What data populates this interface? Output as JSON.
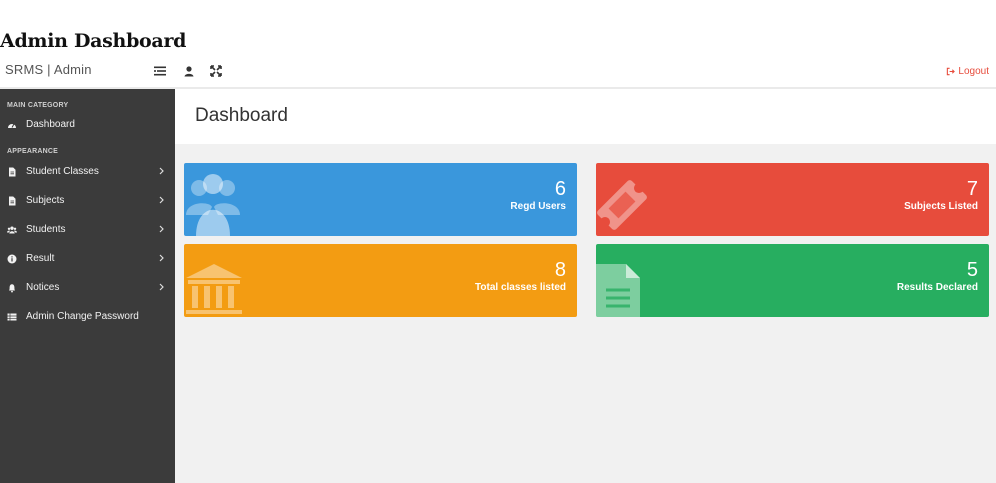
{
  "page": {
    "heading": "Admin Dashboard"
  },
  "topbar": {
    "brand": "SRMS | Admin",
    "icons": [
      "list-toggle-icon",
      "user-icon",
      "expand-icon"
    ],
    "logout_label": "Logout",
    "logout_color": "#e74c3c"
  },
  "sidebar": {
    "bg_color": "#3b3b3b",
    "categories": {
      "main": "MAIN CATEGORY",
      "appearance": "APPEARANCE"
    },
    "items": [
      {
        "label": "Dashboard",
        "icon": "dashboard-icon",
        "has_submenu": false
      },
      {
        "label": "Student Classes",
        "icon": "file-icon",
        "has_submenu": true
      },
      {
        "label": "Subjects",
        "icon": "file-icon",
        "has_submenu": true
      },
      {
        "label": "Students",
        "icon": "users-icon",
        "has_submenu": true
      },
      {
        "label": "Result",
        "icon": "info-icon",
        "has_submenu": true
      },
      {
        "label": "Notices",
        "icon": "bell-icon",
        "has_submenu": true
      },
      {
        "label": "Admin Change Password",
        "icon": "list-icon",
        "has_submenu": false
      }
    ]
  },
  "main": {
    "title": "Dashboard",
    "cards": [
      {
        "count": "6",
        "label": "Regd Users",
        "color": "#3a97dc",
        "icon": "users-group-icon"
      },
      {
        "count": "7",
        "label": "Subjects Listed",
        "color": "#e74c3c",
        "icon": "ticket-icon"
      },
      {
        "count": "8",
        "label": "Total classes listed",
        "color": "#f39c12",
        "icon": "bank-icon"
      },
      {
        "count": "5",
        "label": "Results Declared",
        "color": "#27ae60",
        "icon": "document-icon"
      }
    ]
  }
}
